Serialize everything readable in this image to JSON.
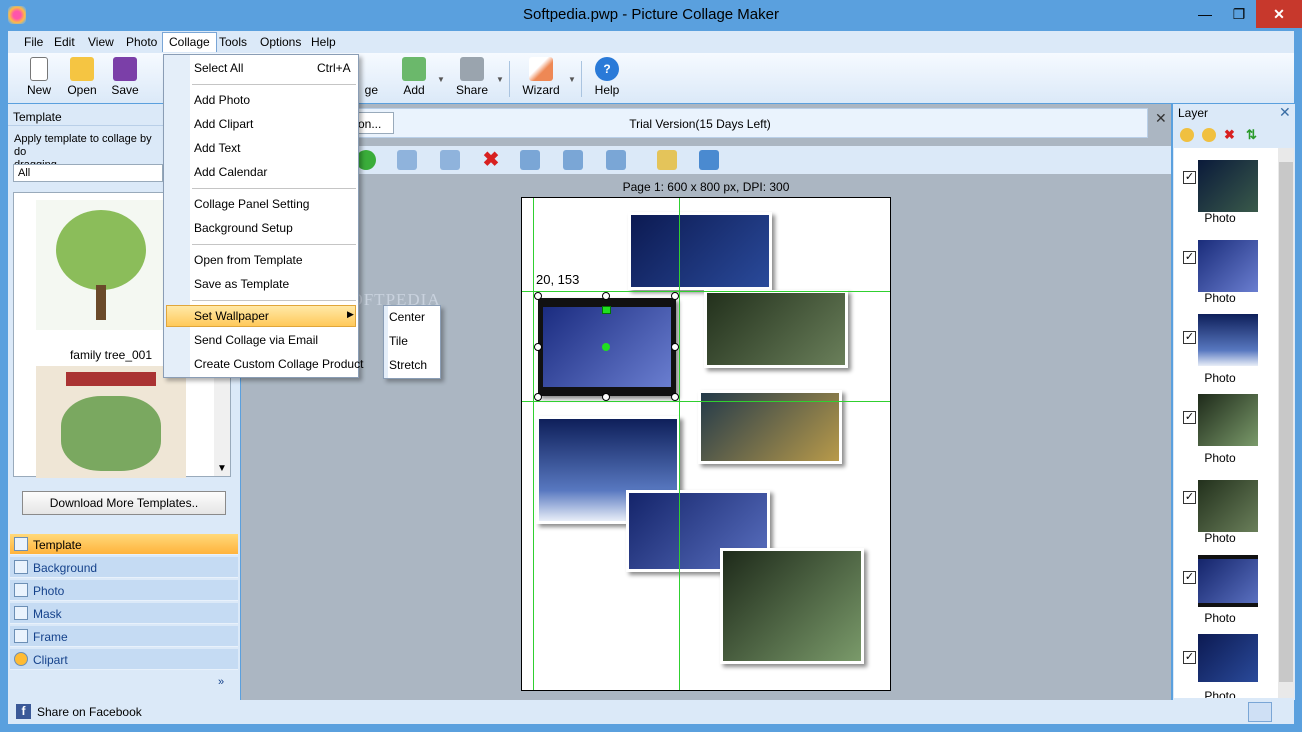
{
  "window": {
    "title": "Softpedia.pwp - Picture Collage Maker"
  },
  "menubar": {
    "items": [
      "File",
      "Edit",
      "View",
      "Photo",
      "Collage",
      "Tools",
      "Options",
      "Help"
    ]
  },
  "toolbar": {
    "new": "New",
    "open": "Open",
    "save": "Save",
    "image_partial": "ge",
    "add": "Add",
    "share": "Share",
    "wizard": "Wizard",
    "help": "Help"
  },
  "collage_menu": {
    "items": [
      {
        "label": "Select All",
        "shortcut": "Ctrl+A"
      },
      {
        "label": "Add Photo"
      },
      {
        "label": "Add Clipart"
      },
      {
        "label": "Add Text"
      },
      {
        "label": "Add Calendar"
      },
      {
        "label": "Collage Panel Setting"
      },
      {
        "label": "Background Setup"
      },
      {
        "label": "Open from Template"
      },
      {
        "label": "Save as Template"
      },
      {
        "label": "Set Wallpaper"
      },
      {
        "label": "Send Collage via Email"
      },
      {
        "label": "Create Custom Collage Product"
      }
    ],
    "submenu": [
      "Center",
      "Tile",
      "Stretch"
    ]
  },
  "left_panel": {
    "title": "Template",
    "description": "Apply template to collage by do... dragging",
    "desc_line1": "Apply template to collage by do",
    "desc_line2": "dragging",
    "filter": "All",
    "template_caption": "family tree_001",
    "download_button": "Download More Templates..",
    "nav": [
      "Template",
      "Background",
      "Photo",
      "Mask",
      "Frame",
      "Clipart"
    ],
    "selected_nav": "Template"
  },
  "center": {
    "trial_button": "on...",
    "trial_text": "Trial Version(15 Days Left)",
    "page_info": "Page 1: 600 x 800 px, DPI: 300",
    "coordinate": "20, 153",
    "watermark": "SOFTPEDIA"
  },
  "right_panel": {
    "title": "Layer",
    "layers": [
      "Photo",
      "Photo",
      "Photo",
      "Photo",
      "Photo",
      "Photo",
      "Photo"
    ]
  },
  "status": {
    "share": "Share on Facebook"
  },
  "colors": {
    "accent": "#5aa0de",
    "selected": "#ffb33c",
    "guide": "#30d030",
    "close": "#c7382c"
  }
}
